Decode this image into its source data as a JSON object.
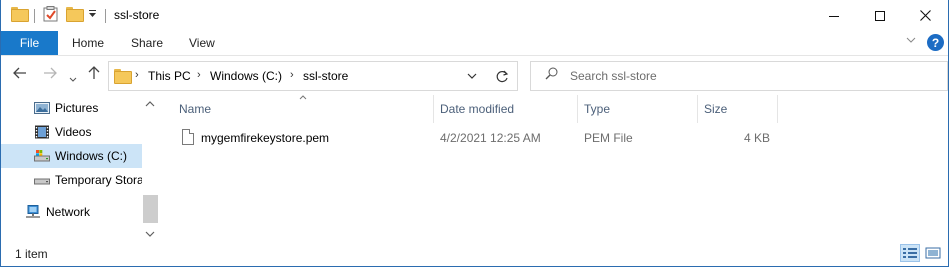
{
  "window": {
    "title": "ssl-store",
    "minimize_icon": "minimize-icon",
    "maximize_icon": "maximize-icon",
    "close_icon": "close-icon"
  },
  "quick_access": {
    "icons": [
      "folder-icon",
      "properties-checkmark-icon",
      "new-folder-icon",
      "customize-dropdown-icon"
    ]
  },
  "ribbon": {
    "tabs": [
      "File",
      "Home",
      "Share",
      "View"
    ],
    "active_tab": "File",
    "accent_color": "#1979ca",
    "help_label": "?"
  },
  "nav": {
    "back_icon": "back-arrow-icon",
    "forward_icon": "forward-arrow-icon",
    "recent_icon": "recent-locations-chevron-icon",
    "up_icon": "up-arrow-icon",
    "breadcrumbs": [
      "This PC",
      "Windows (C:)",
      "ssl-store"
    ],
    "refresh_icon": "refresh-icon",
    "search_placeholder": "Search ssl-store"
  },
  "sidebar": {
    "items": [
      {
        "label": "Pictures",
        "icon": "pictures-icon",
        "selected": false
      },
      {
        "label": "Videos",
        "icon": "videos-icon",
        "selected": false
      },
      {
        "label": "Windows (C:)",
        "icon": "drive-icon",
        "selected": true
      },
      {
        "label": "Temporary Stora",
        "icon": "drive-icon",
        "selected": false
      },
      {
        "label": "Network",
        "icon": "network-icon",
        "selected": false
      }
    ]
  },
  "file_list": {
    "columns": [
      "Name",
      "Date modified",
      "Type",
      "Size"
    ],
    "rows": [
      {
        "name": "mygemfirekeystore.pem",
        "date_modified": "4/2/2021 12:25 AM",
        "type": "PEM File",
        "size": "4 KB"
      }
    ]
  },
  "status": {
    "item_count": "1 item",
    "views": [
      "details-view-icon",
      "large-icons-view-icon"
    ]
  }
}
